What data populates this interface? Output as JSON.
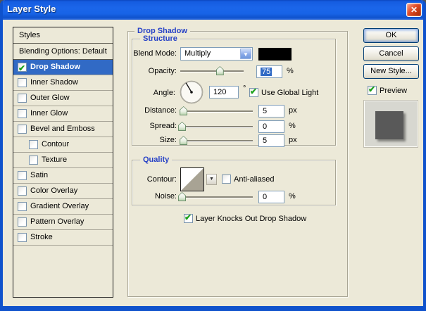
{
  "window": {
    "title": "Layer Style",
    "close_icon": "✕"
  },
  "sidebar": {
    "items": [
      {
        "label": "Styles",
        "type": "plain"
      },
      {
        "label": "Blending Options: Default",
        "type": "plain"
      },
      {
        "label": "Drop Shadow",
        "type": "check",
        "checked": true,
        "selected": true
      },
      {
        "label": "Inner Shadow",
        "type": "check",
        "checked": false
      },
      {
        "label": "Outer Glow",
        "type": "check",
        "checked": false
      },
      {
        "label": "Inner Glow",
        "type": "check",
        "checked": false
      },
      {
        "label": "Bevel and Emboss",
        "type": "check",
        "checked": false
      },
      {
        "label": "Contour",
        "type": "check",
        "checked": false,
        "indent": true
      },
      {
        "label": "Texture",
        "type": "check",
        "checked": false,
        "indent": true
      },
      {
        "label": "Satin",
        "type": "check",
        "checked": false
      },
      {
        "label": "Color Overlay",
        "type": "check",
        "checked": false
      },
      {
        "label": "Gradient Overlay",
        "type": "check",
        "checked": false
      },
      {
        "label": "Pattern Overlay",
        "type": "check",
        "checked": false
      },
      {
        "label": "Stroke",
        "type": "check",
        "checked": false
      }
    ]
  },
  "main": {
    "group_title": "Drop Shadow",
    "structure": {
      "title": "Structure",
      "blend_mode": {
        "label": "Blend Mode:",
        "value": "Multiply",
        "swatch_color": "#000000",
        "arrow_icon": "▼"
      },
      "opacity": {
        "label": "Opacity:",
        "value": "75",
        "unit": "%",
        "thumb_percent": 62
      },
      "angle": {
        "label": "Angle:",
        "value": "120",
        "unit": "°",
        "degrees": 120,
        "global_light_label": "Use Global Light",
        "global_light_checked": true
      },
      "distance": {
        "label": "Distance:",
        "value": "5",
        "unit": "px",
        "thumb_percent": 4
      },
      "spread": {
        "label": "Spread:",
        "value": "0",
        "unit": "%",
        "thumb_percent": 2
      },
      "size": {
        "label": "Size:",
        "value": "5",
        "unit": "px",
        "thumb_percent": 4
      }
    },
    "quality": {
      "title": "Quality",
      "contour": {
        "label": "Contour:",
        "arrow_icon": "▼"
      },
      "anti_aliased": {
        "label": "Anti-aliased",
        "checked": false
      },
      "noise": {
        "label": "Noise:",
        "value": "0",
        "unit": "%",
        "thumb_percent": 2
      }
    },
    "knockout": {
      "label": "Layer Knocks Out Drop Shadow",
      "checked": true
    }
  },
  "actions": {
    "ok": "OK",
    "cancel": "Cancel",
    "new_style": "New Style...",
    "preview": {
      "label": "Preview",
      "checked": true
    }
  },
  "colors": {
    "selection": "#316ac5",
    "legend_blue": "#2641c6",
    "swatch": "#000000"
  }
}
